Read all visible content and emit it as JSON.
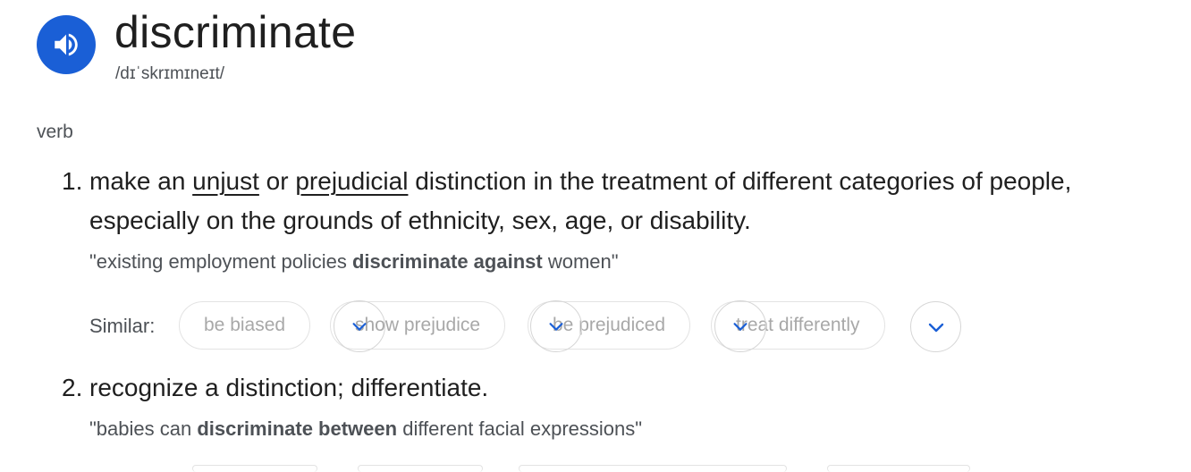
{
  "entry": {
    "word": "discriminate",
    "phonetic": "/dɪˈskrɪmɪneɪt/",
    "speaker_icon": "speaker-icon",
    "part_of_speech": "verb"
  },
  "senses": [
    {
      "number": "1.",
      "definition": {
        "pre": "make an ",
        "link1": "unjust",
        "mid": " or ",
        "link2": "prejudicial",
        "post": " distinction in the treatment of different categories of people, especially on the grounds of ethnicity, sex, age, or disability."
      },
      "example": {
        "pre": "\"existing employment policies ",
        "bold": "discriminate against",
        "post": " women\""
      },
      "similar_label": "Similar:",
      "similar": [
        "be biased",
        "show prejudice",
        "be prejudiced",
        "treat differently"
      ]
    },
    {
      "number": "2.",
      "definition_text": "recognize a distinction; differentiate.",
      "example": {
        "pre": "\"babies can ",
        "bold": "discriminate between",
        "post": " different facial expressions\""
      }
    }
  ],
  "colors": {
    "accent": "#1a5fd6",
    "text": "#1f1f1f",
    "muted": "#4d5156",
    "chip_text": "#a8a8a8"
  }
}
